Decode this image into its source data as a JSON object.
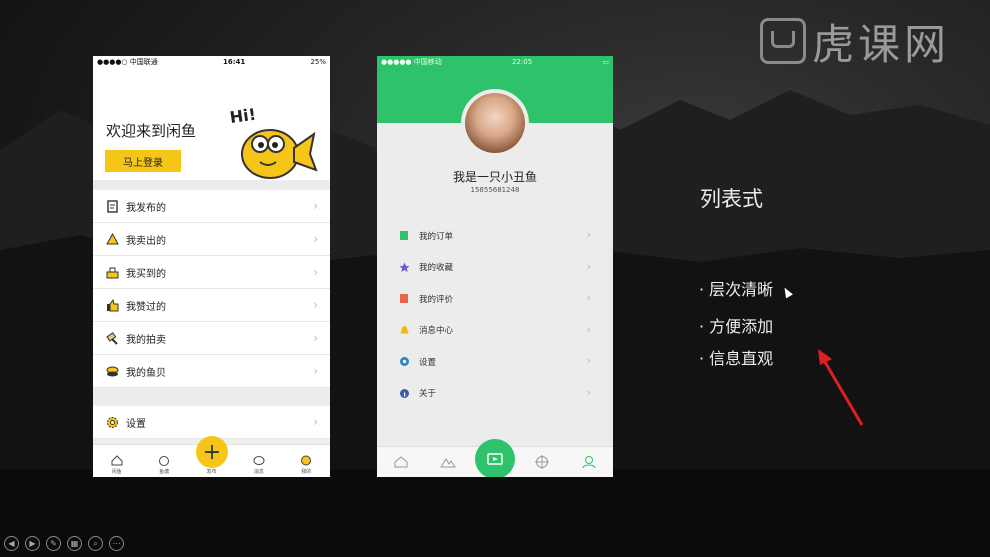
{
  "watermark": {
    "text": "虎课网"
  },
  "phone1": {
    "status": {
      "carrier": "●●●●○ 中国联通",
      "time": "16:41",
      "battery": "25%"
    },
    "welcome": "欢迎来到闲鱼",
    "fish_text": "Hi!",
    "login_button": "马上登录",
    "items": [
      {
        "label": "我发布的",
        "icon": "publish-icon"
      },
      {
        "label": "我卖出的",
        "icon": "sold-icon"
      },
      {
        "label": "我买到的",
        "icon": "bought-icon"
      },
      {
        "label": "我赞过的",
        "icon": "thumbs-up-icon"
      },
      {
        "label": "我的拍卖",
        "icon": "auction-icon"
      },
      {
        "label": "我的鱼贝",
        "icon": "shell-icon"
      }
    ],
    "settings": {
      "label": "设置",
      "icon": "gear-icon"
    },
    "tabs": [
      {
        "label": "闲鱼",
        "icon": "home-icon"
      },
      {
        "label": "鱼塘",
        "icon": "pond-icon"
      },
      {
        "label": "发布",
        "icon": "plus-icon"
      },
      {
        "label": "消息",
        "icon": "message-icon"
      },
      {
        "label": "我的",
        "icon": "profile-icon"
      }
    ],
    "plus": "+"
  },
  "phone2": {
    "status": {
      "carrier": "●●●●● 中国移动",
      "time": "22:05"
    },
    "name": "我是一只小丑鱼",
    "phone": "15855681248",
    "items": [
      {
        "label": "我的订单",
        "icon": "order-icon",
        "color": "#2ec26a"
      },
      {
        "label": "我的收藏",
        "icon": "star-icon",
        "color": "#6b5fc7"
      },
      {
        "label": "我的评价",
        "icon": "comment-icon",
        "color": "#e8664a"
      },
      {
        "label": "消息中心",
        "icon": "bell-icon",
        "color": "#f0b81a"
      },
      {
        "label": "设置",
        "icon": "gear-icon",
        "color": "#2a83c7"
      },
      {
        "label": "关于",
        "icon": "info-icon",
        "color": "#3d5ea8"
      }
    ],
    "accent": "#2ec26a"
  },
  "slide": {
    "heading": "列表式",
    "bullets": [
      "· 层次清晰",
      "· 方便添加",
      "· 信息直观"
    ]
  },
  "colors": {
    "yellow": "#f5c518",
    "green": "#2ec26a",
    "arrow": "#e02020"
  }
}
